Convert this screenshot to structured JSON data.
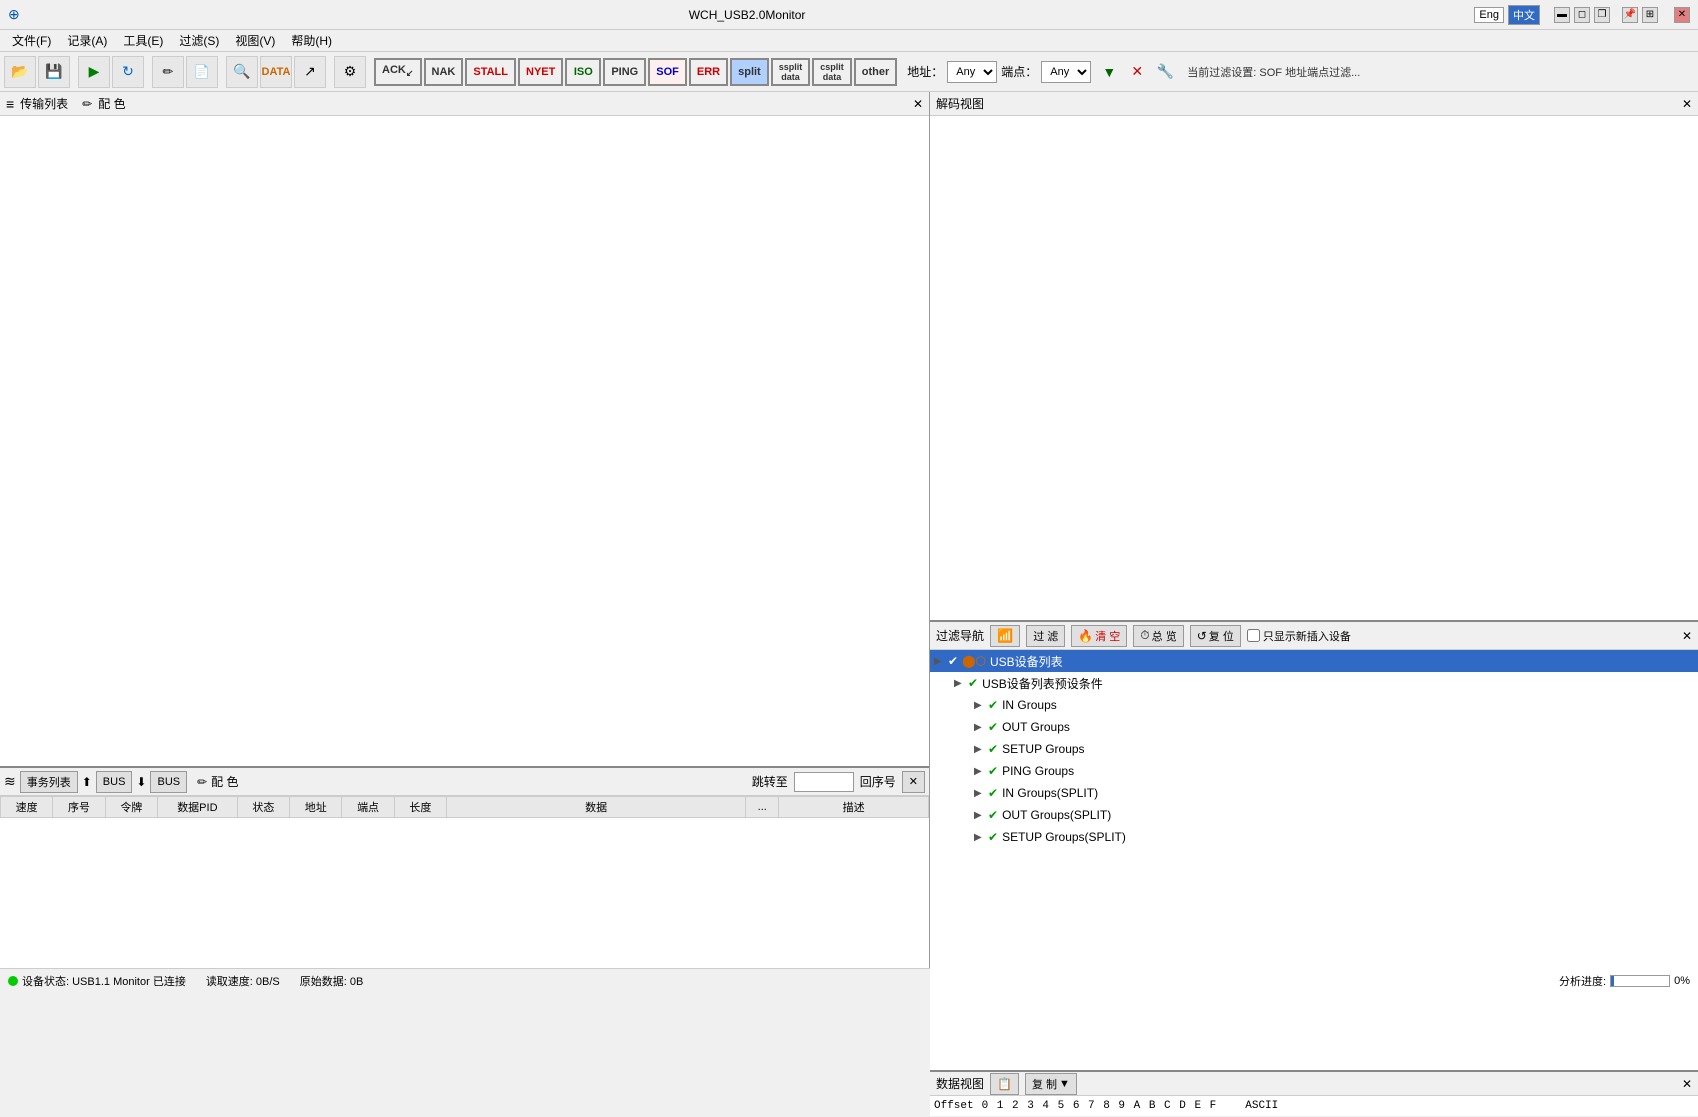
{
  "app": {
    "title": "WCH_USB2.0Monitor",
    "lang_eng": "Eng",
    "lang_chs": "中文"
  },
  "menu": {
    "items": [
      "文件(F)",
      "记录(A)",
      "工具(E)",
      "过滤(S)",
      "视图(V)",
      "帮助(H)"
    ]
  },
  "toolbar": {
    "filter_buttons": [
      {
        "label": "ACK",
        "sub": "",
        "class": "filter-ack"
      },
      {
        "label": "NAK",
        "sub": "",
        "class": "filter-nak"
      },
      {
        "label": "STALL",
        "sub": "",
        "class": "filter-stall"
      },
      {
        "label": "NYET",
        "sub": "",
        "class": "filter-nyet"
      },
      {
        "label": "ISO",
        "sub": "",
        "class": "filter-iso"
      },
      {
        "label": "PING",
        "sub": "",
        "class": "filter-ping"
      },
      {
        "label": "SOF",
        "sub": "",
        "class": "filter-sof"
      },
      {
        "label": "ERR",
        "sub": "",
        "class": "filter-err"
      },
      {
        "label": "split",
        "sub": "",
        "class": "filter-split"
      },
      {
        "label": "ssplit data",
        "sub": "",
        "class": "filter-ssplit"
      },
      {
        "label": "csplit data",
        "sub": "",
        "class": "filter-csplit"
      },
      {
        "label": "other",
        "sub": "",
        "class": "filter-other"
      }
    ],
    "addr_label": "地址：",
    "addr_placeholder": "Any",
    "endpoint_label": "端点：",
    "endpoint_placeholder": "Any",
    "current_filter_label": "当前过滤设置: SOF  地址端点过滤..."
  },
  "trans_panel": {
    "title": "传输列表",
    "config_label": "配 色"
  },
  "bus_panel": {
    "title": "事务列表",
    "bus_label": "BUS",
    "config_label": "配 色",
    "jump_to": "跳转至",
    "order": "回序号",
    "columns": [
      "速度",
      "序号",
      "令牌",
      "数据PID",
      "状态",
      "地址",
      "端点",
      "长度",
      "数据",
      "...",
      "描述"
    ]
  },
  "decode_panel": {
    "title": "解码视图"
  },
  "filter_nav": {
    "title": "过滤导航",
    "buttons": [
      "过 滤",
      "清 空",
      "总 览",
      "复 位"
    ],
    "only_new_label": "只显示新插入设备",
    "tree": {
      "root": {
        "label": "USB设备列表",
        "checked": true,
        "selected": true,
        "conditions": {
          "label": "USB设备列表预设条件",
          "checked": true,
          "children": [
            {
              "label": "IN Groups",
              "checked": true
            },
            {
              "label": "OUT Groups",
              "checked": true
            },
            {
              "label": "SETUP Groups",
              "checked": true
            },
            {
              "label": "PING Groups",
              "checked": true
            },
            {
              "label": "IN Groups(SPLIT)",
              "checked": true
            },
            {
              "label": "OUT Groups(SPLIT)",
              "checked": true
            },
            {
              "label": "SETUP Groups(SPLIT)",
              "checked": true
            }
          ]
        }
      }
    }
  },
  "data_view": {
    "title": "数据视图",
    "copy_label": "复 制",
    "offset_label": "Offset",
    "hex_cols": "0  1  2  3  4  5  6  7  8  9  A  B  C  D  E  F",
    "ascii_label": "ASCII"
  },
  "status_bar": {
    "device_status": "设备状态: USB1.1 Monitor 已连接",
    "read_speed_label": "读取速度: 0B/S",
    "raw_data_label": "原始数据: 0B",
    "analysis_progress": "分析进度:",
    "progress_value": "0%"
  }
}
